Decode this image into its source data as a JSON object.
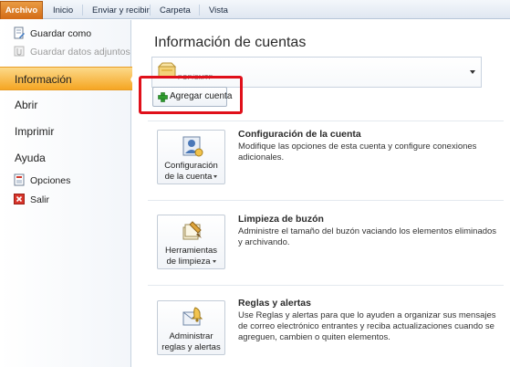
{
  "ribbon": {
    "tabs": [
      "Archivo",
      "Inicio",
      "Enviar y recibir",
      "Carpeta",
      "Vista"
    ]
  },
  "nav": {
    "save_as": "Guardar como",
    "save_attachments": "Guardar datos adjuntos",
    "info": "Información",
    "open": "Abrir",
    "print": "Imprimir",
    "help": "Ayuda",
    "options": "Opciones",
    "exit": "Salir"
  },
  "main": {
    "title": "Información de cuentas",
    "account_selector_text": "POP/SMTP",
    "add_account_label": "Agregar cuenta",
    "sections": [
      {
        "button_line1": "Configuración",
        "button_line2": "de la cuenta",
        "title": "Configuración de la cuenta",
        "description": "Modifique las opciones de esta cuenta y configure conexiones adicionales."
      },
      {
        "button_line1": "Herramientas",
        "button_line2": "de limpieza",
        "title": "Limpieza de buzón",
        "description": "Administre el tamaño del buzón vaciando los elementos eliminados y archivando."
      },
      {
        "button_line1": "Administrar",
        "button_line2": "reglas y alertas",
        "title": "Reglas y alertas",
        "description": "Use Reglas y alertas para que lo ayuden a organizar sus mensajes de correo electrónico entrantes y reciba actualizaciones cuando se agreguen, cambien o quiten elementos."
      }
    ]
  },
  "colors": {
    "file_tab": "#d36b16",
    "active_nav": "#f5a623",
    "highlight": "#e0101a"
  }
}
